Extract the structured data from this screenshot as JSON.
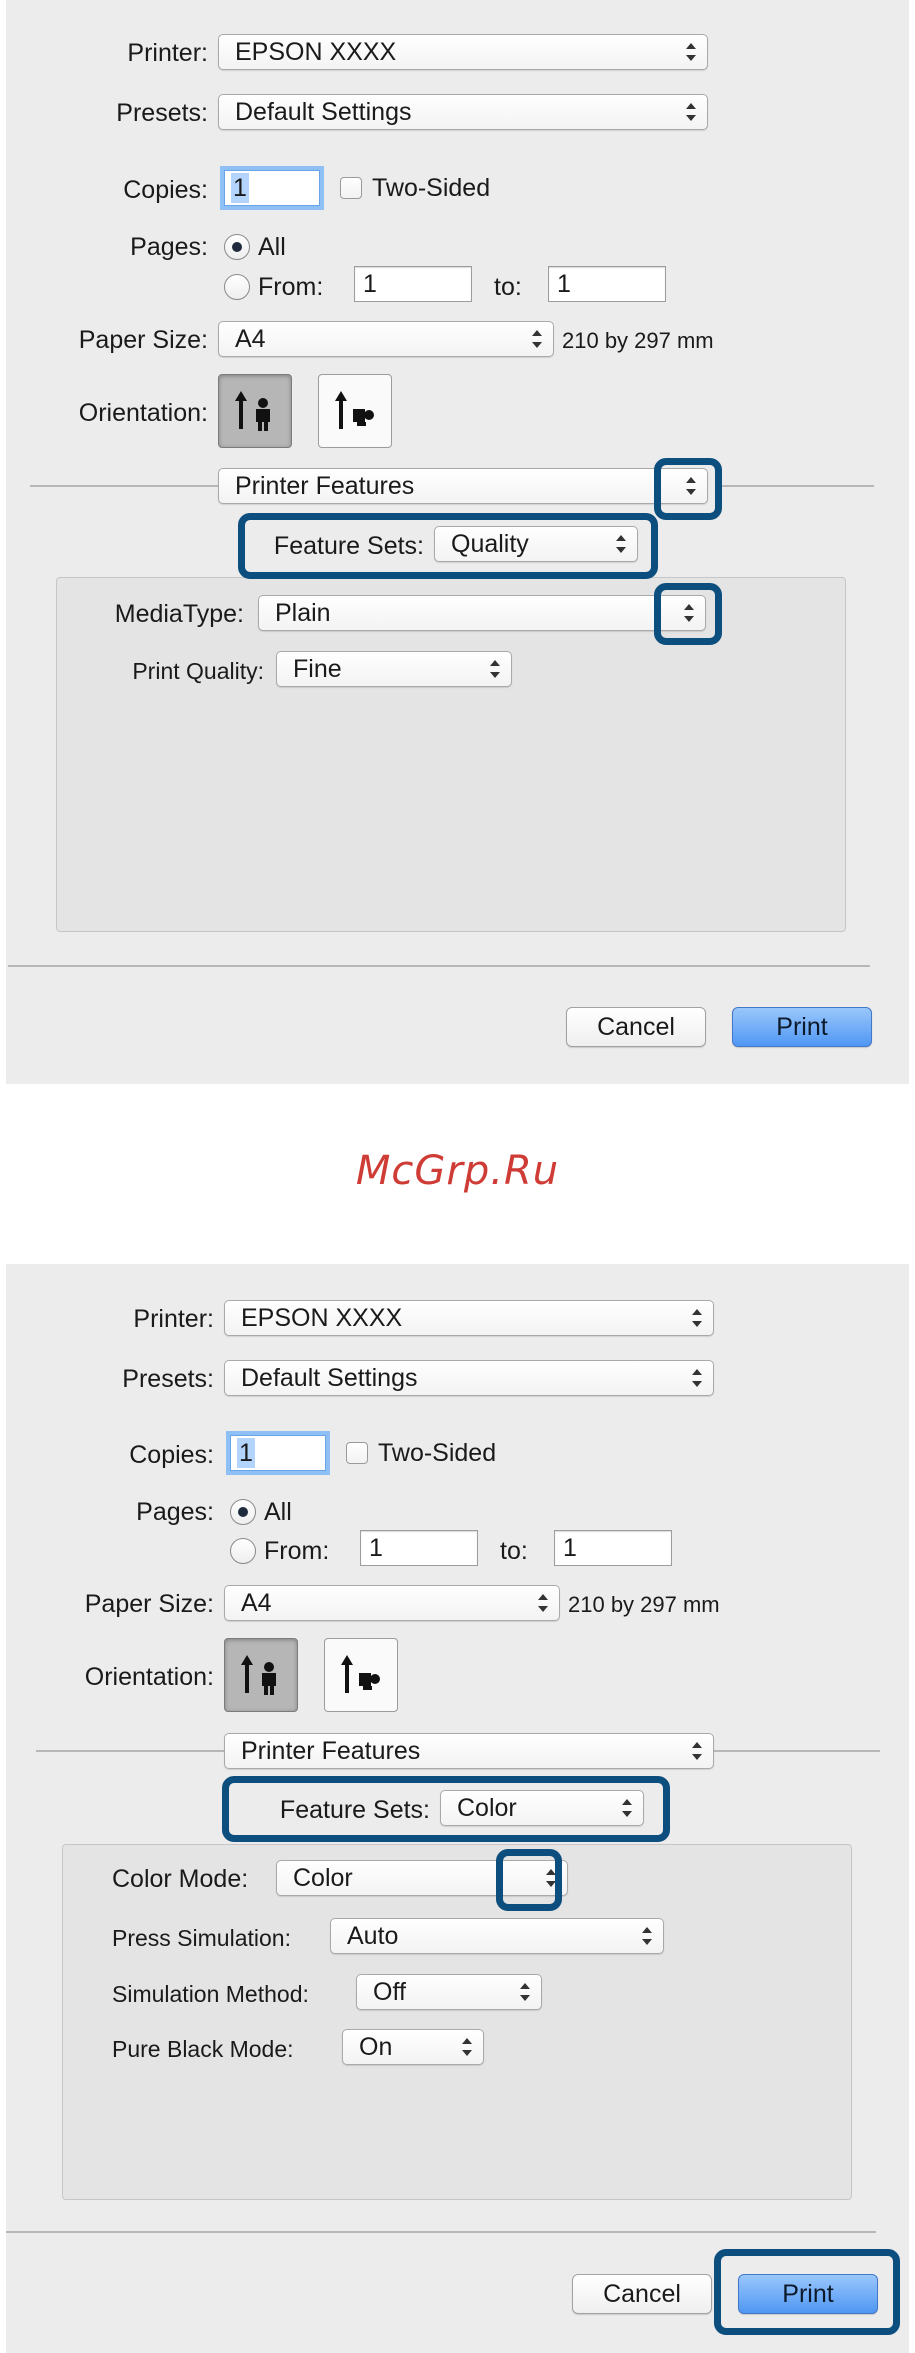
{
  "dialog1": {
    "printer": {
      "label": "Printer:",
      "value": "EPSON XXXX"
    },
    "presets": {
      "label": "Presets:",
      "value": "Default Settings"
    },
    "copies": {
      "label": "Copies:",
      "value": "1",
      "two_sided_label": "Two-Sided"
    },
    "pages": {
      "label": "Pages:",
      "all_label": "All",
      "from_label": "From:",
      "from_value": "1",
      "to_label": "to:",
      "to_value": "1"
    },
    "paper_size": {
      "label": "Paper Size:",
      "value": "A4",
      "dimensions": "210 by 297 mm"
    },
    "orientation": {
      "label": "Orientation:"
    },
    "section_menu": {
      "value": "Printer Features"
    },
    "feature_sets": {
      "label": "Feature Sets:",
      "value": "Quality"
    },
    "settings": [
      {
        "label": "MediaType:",
        "value": "Plain"
      },
      {
        "label": "Print Quality:",
        "value": "Fine"
      }
    ],
    "buttons": {
      "cancel": "Cancel",
      "print": "Print"
    }
  },
  "watermark": "McGrp.Ru",
  "dialog2": {
    "printer": {
      "label": "Printer:",
      "value": "EPSON XXXX"
    },
    "presets": {
      "label": "Presets:",
      "value": "Default Settings"
    },
    "copies": {
      "label": "Copies:",
      "value": "1",
      "two_sided_label": "Two-Sided"
    },
    "pages": {
      "label": "Pages:",
      "all_label": "All",
      "from_label": "From:",
      "from_value": "1",
      "to_label": "to:",
      "to_value": "1"
    },
    "paper_size": {
      "label": "Paper Size:",
      "value": "A4",
      "dimensions": "210 by 297 mm"
    },
    "orientation": {
      "label": "Orientation:"
    },
    "section_menu": {
      "value": "Printer Features"
    },
    "feature_sets": {
      "label": "Feature Sets:",
      "value": "Color"
    },
    "settings": [
      {
        "label": "Color Mode:",
        "value": "Color"
      },
      {
        "label": "Press Simulation:",
        "value": "Auto"
      },
      {
        "label": "Simulation Method:",
        "value": "Off"
      },
      {
        "label": "Pure Black Mode:",
        "value": "On"
      }
    ],
    "buttons": {
      "cancel": "Cancel",
      "print": "Print"
    }
  },
  "colors": {
    "highlight": "#0c4e7e",
    "watermark": "#cf3b35",
    "primary_button": "#4f97f4"
  }
}
